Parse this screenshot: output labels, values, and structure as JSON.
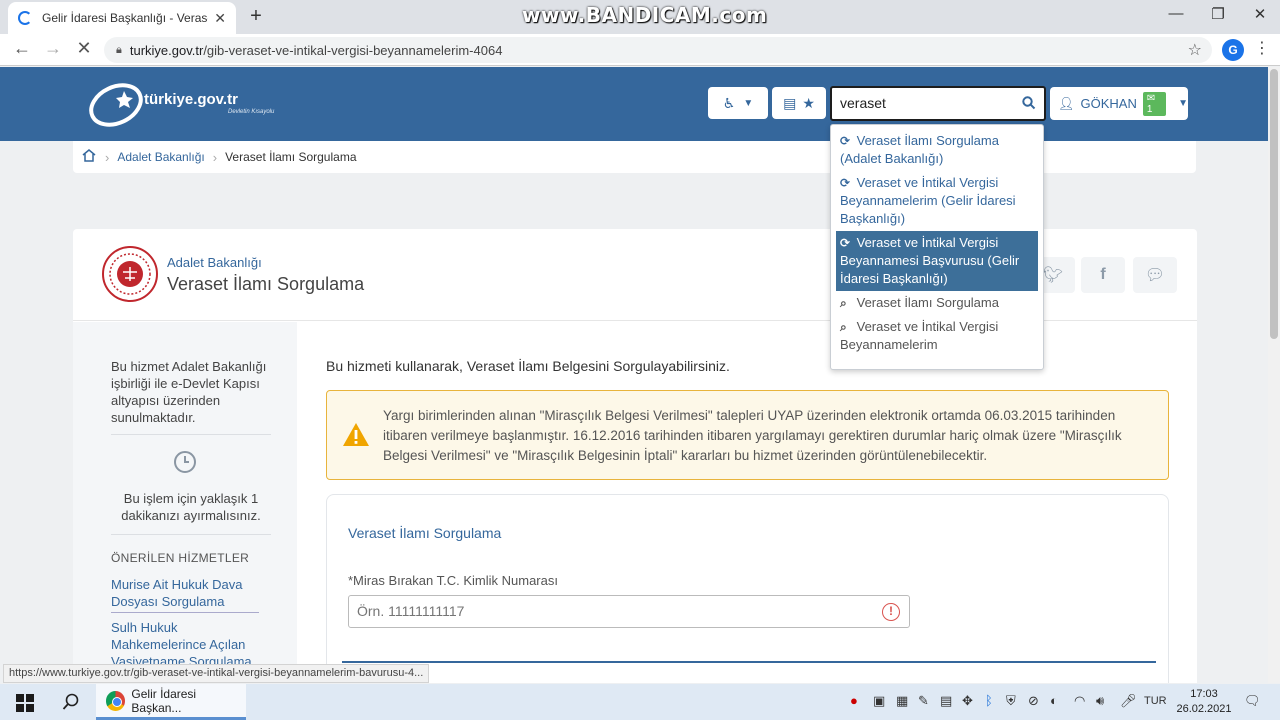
{
  "browser": {
    "tab_title": "Gelir İdaresi Başkanlığı - Veraset",
    "tab_close": "✕",
    "new_tab": "+",
    "watermark": "www.BANDICAM.com",
    "url_host": "turkiye.gov.tr",
    "url_path": "/gib-veraset-ve-intikal-vergisi-beyannamelerim-4064",
    "profile_initial": "G",
    "status_url": "https://www.turkiye.gov.tr/gib-veraset-ve-intikal-vergisi-beyannamelerim-bavurusu-4..."
  },
  "header": {
    "logo_text": "türkiye.gov.tr",
    "logo_tagline": "Devletin Kısayolu",
    "search_value": "veraset",
    "user_name": "GÖKHAN",
    "message_count": "1"
  },
  "breadcrumb": {
    "items": [
      "Adalet Bakanlığı",
      "Veraset İlamı Sorgulama"
    ]
  },
  "search_suggestions": [
    {
      "icon": "refresh-icon",
      "text": "Veraset İlamı Sorgulama (Adalet Bakanlığı)",
      "active": false
    },
    {
      "icon": "refresh-icon",
      "text": "Veraset ve İntikal Vergisi Beyannamelerim (Gelir İdaresi Başkanlığı)",
      "active": false
    },
    {
      "icon": "refresh-icon",
      "text": "Veraset ve İntikal Vergisi Beyannamesi Başvurusu (Gelir İdaresi Başkanlığı)",
      "active": true
    },
    {
      "icon": "search-icon",
      "text": "Veraset İlamı Sorgulama",
      "active": false
    },
    {
      "icon": "search-icon",
      "text": "Veraset ve İntikal Vergisi Beyannamelerim",
      "active": false
    }
  ],
  "service": {
    "ministry": "Adalet Bakanlığı",
    "title": "Veraset İlamı Sorgulama"
  },
  "sidebar": {
    "info": "Bu hizmet Adalet Bakanlığı işbirliği ile e-Devlet Kapısı altyapısı üzerinden sunulmaktadır.",
    "time_note": "Bu işlem için yaklaşık 1 dakikanızı ayırmalısınız.",
    "recommended_title": "ÖNERİLEN HİZMETLER",
    "recommended": [
      "Murise Ait Hukuk Dava Dosyası Sorgulama",
      "Sulh Hukuk Mahkemelerince Açılan Vasiyetname Sorgulama"
    ]
  },
  "main": {
    "intro": "Bu hizmeti kullanarak, Veraset İlamı Belgesini Sorgulayabilirsiniz.",
    "alert": "Yargı birimlerinden alınan \"Mirasçılık Belgesi Verilmesi\" talepleri UYAP üzerinden elektronik ortamda 06.03.2015 tarihinden itibaren verilmeye başlanmıştır. 16.12.2016 tarihinden itibaren yargılamayı gerektiren durumlar hariç olmak üzere \"Mirasçılık Belgesi Verilmesi\" ve \"Mirasçılık Belgesinin İptali\" kararları bu hizmet üzerinden görüntülenebilecektir.",
    "form_title": "Veraset İlamı Sorgulama",
    "field_label": "*Miras Bırakan T.C. Kimlik Numarası",
    "field_placeholder": "Örn. 11111111117"
  },
  "taskbar": {
    "app_label": "Gelir İdaresi Başkan...",
    "lang": "TUR",
    "time": "17:03",
    "date": "26.02.2021"
  },
  "colors": {
    "brand": "#35679c",
    "alert_border": "#e8b43c",
    "alert_bg": "#fdf8e8"
  }
}
